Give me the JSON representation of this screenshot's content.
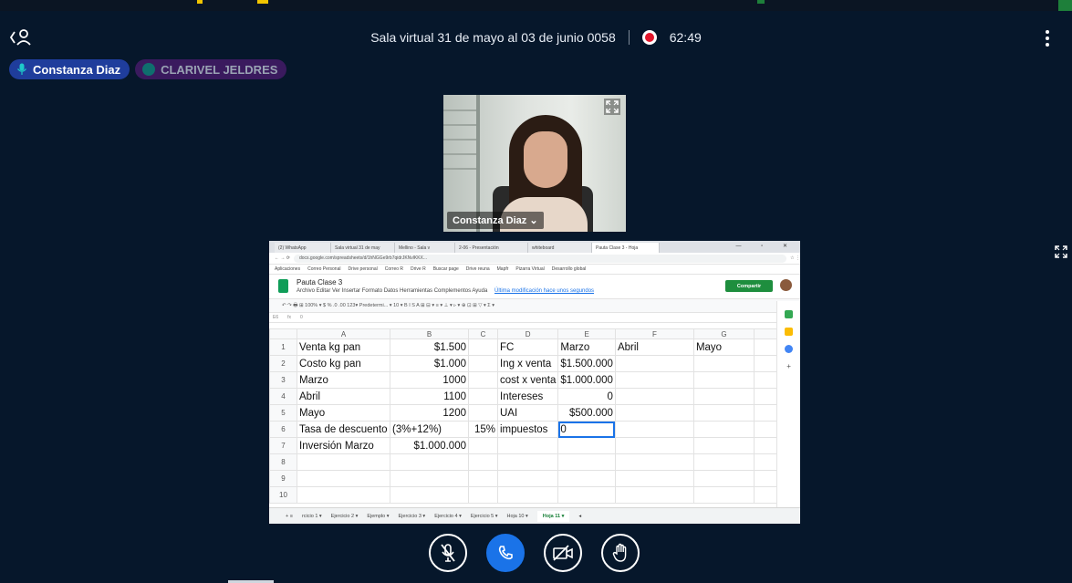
{
  "header": {
    "title": "Sala virtual 31 de mayo al 03 de junio 0058",
    "timer": "62:49"
  },
  "participants": [
    {
      "name": "Constanza Diaz"
    },
    {
      "name": "CLARIVEL JELDRES"
    }
  ],
  "webcam": {
    "label": "Constanza Diaz ⌄"
  },
  "shared_screen": {
    "browser_tabs": [
      "(2) WhatsApp",
      "Sala virtual 31 de may",
      "Mellino - Sala v",
      "2-06 - Presentación",
      "whiteboard",
      "Pauta Clase 3 - Hoja"
    ],
    "url": "docs.google.com/spreadsheets/d/1hNGGe9rb7qidrJKNvlKKX...",
    "bookmarks": [
      "Aplicaciones",
      "Correo Personal",
      "Drive personal",
      "Correo R",
      "Drive R",
      "Buscar page",
      "Drive reuna",
      "Mapfr",
      "Pizarra Virtual",
      "Desarrollo global"
    ],
    "doc_title": "Pauta Clase 3",
    "doc_menu": "Archivo  Editar  Ver  Insertar  Formato  Datos  Herramientas  Complementos  Ayuda",
    "last_edit": "Última modificación hace unos segundos",
    "share_label": "Compartir",
    "toolbar_text": "↶ ↷ 🖶 ⊞   100% ▾   $  %  .0  .00  123▾   Predetermi... ▾   10 ▾   B  I  S  A   ⊞  ⊟ ▾   ≡ ▾  ⊥ ▾  ▹ ▾   ⊕  ⊡  ⊞  ▽ ▾  Σ ▾",
    "cell_ref": "E6",
    "formula_value": "0",
    "column_headers": [
      "A",
      "B",
      "C",
      "D",
      "E",
      "F",
      "G"
    ],
    "rows": [
      {
        "n": "1",
        "cells": [
          "Venta kg pan",
          "$1.500",
          "",
          "FC",
          "Marzo",
          "Abril",
          "Mayo"
        ]
      },
      {
        "n": "2",
        "cells": [
          "Costo kg pan",
          "$1.000",
          "",
          "Ing x venta",
          "$1.500.000",
          "",
          ""
        ]
      },
      {
        "n": "3",
        "cells": [
          "Marzo",
          "1000",
          "",
          "cost x venta",
          "$1.000.000",
          "",
          ""
        ]
      },
      {
        "n": "4",
        "cells": [
          "Abril",
          "1100",
          "",
          "Intereses",
          "0",
          "",
          ""
        ]
      },
      {
        "n": "5",
        "cells": [
          "Mayo",
          "1200",
          "",
          "UAI",
          "$500.000",
          "",
          ""
        ]
      },
      {
        "n": "6",
        "cells": [
          "Tasa de descuento",
          "(3%+12%)",
          "15%",
          "impuestos",
          "0",
          "",
          ""
        ]
      },
      {
        "n": "7",
        "cells": [
          "Inversión Marzo",
          "$1.000.000",
          "",
          "",
          "",
          "",
          ""
        ]
      },
      {
        "n": "8",
        "cells": [
          "",
          "",
          "",
          "",
          "",
          "",
          ""
        ]
      },
      {
        "n": "9",
        "cells": [
          "",
          "",
          "",
          "",
          "",
          "",
          ""
        ]
      },
      {
        "n": "10",
        "cells": [
          "",
          "",
          "",
          "",
          "",
          "",
          ""
        ]
      }
    ],
    "sheet_tabs": [
      "+  ≡",
      "rcicio 1 ▾",
      "Ejercicio 2 ▾",
      "Ejemplo ▾",
      "Ejercicio 3 ▾",
      "Ejercicio 4 ▾",
      "Ejercicio 5 ▾",
      "Hoja 10 ▾",
      "Hoja 11 ▾",
      "◂"
    ]
  },
  "controls": [
    "mic-off",
    "phone",
    "camera-off",
    "raise-hand"
  ],
  "colors": {
    "background": "#06172b",
    "accent": "#1a73e8",
    "record": "#e3162b"
  }
}
